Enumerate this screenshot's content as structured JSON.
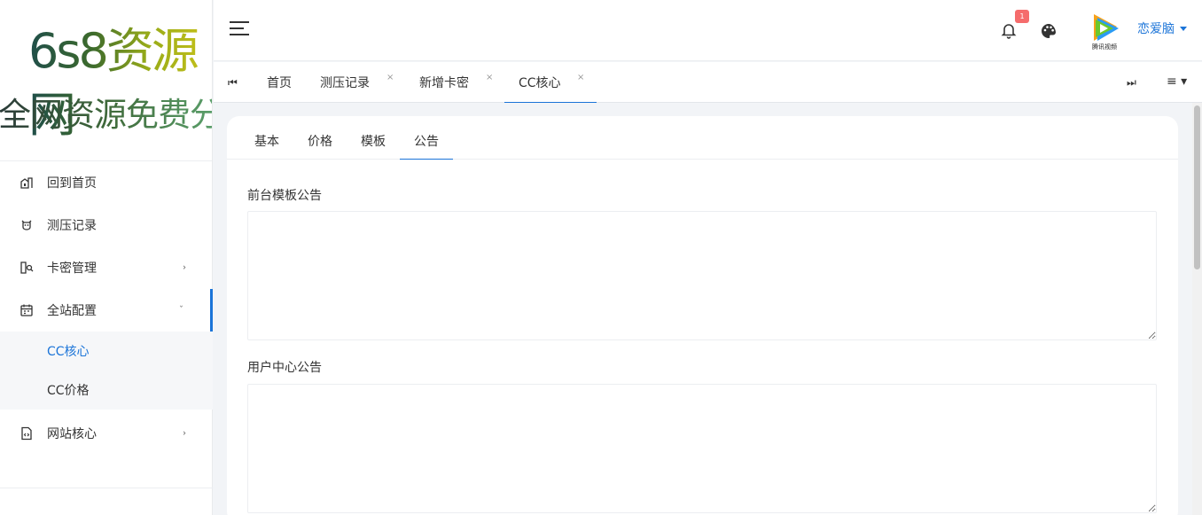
{
  "logo": {
    "line1": "6s8资源网",
    "line2": "全网资源免费分享平台"
  },
  "sidebar": {
    "items": [
      {
        "label": "回到首页",
        "icon": "home-icon"
      },
      {
        "label": "测压记录",
        "icon": "cow-icon"
      },
      {
        "label": "卡密管理",
        "icon": "key-card-icon",
        "arrow": "›"
      },
      {
        "label": "全站配置",
        "icon": "calendar-config-icon",
        "arrow": "ˇ"
      },
      {
        "label": "网站核心",
        "icon": "file-code-icon",
        "arrow": "›"
      }
    ],
    "submenu": [
      {
        "label": "CC核心"
      },
      {
        "label": "CC价格"
      }
    ]
  },
  "header": {
    "notification_count": "1",
    "username": "恋爱脑",
    "avatar_caption": "腾讯视频"
  },
  "tabsbar": {
    "first_icon": "⏮",
    "last_icon": "⏭",
    "menu_icon": "≡ ▾",
    "tabs": [
      {
        "label": "首页"
      },
      {
        "label": "测压记录",
        "close": "×"
      },
      {
        "label": "新增卡密",
        "close": "×"
      },
      {
        "label": "CC核心",
        "close": "×"
      }
    ]
  },
  "card": {
    "tabs": [
      {
        "label": "基本"
      },
      {
        "label": "价格"
      },
      {
        "label": "模板"
      },
      {
        "label": "公告"
      }
    ],
    "fields": [
      {
        "label": "前台模板公告",
        "value": ""
      },
      {
        "label": "用户中心公告",
        "value": ""
      }
    ]
  },
  "colors": {
    "accent": "#1b74d8",
    "badge": "#f56c6c",
    "background": "#f2f4f7"
  }
}
